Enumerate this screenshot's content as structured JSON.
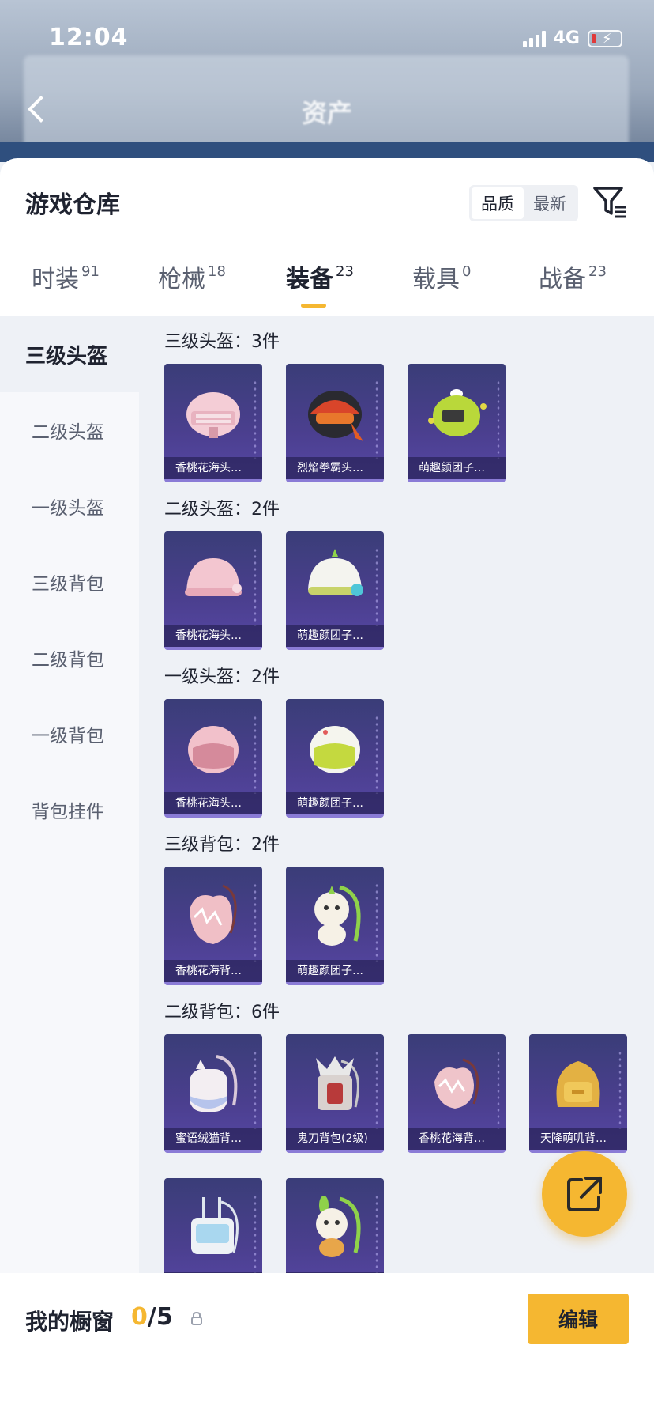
{
  "status_bar": {
    "time": "12:04",
    "network": "4G"
  },
  "header": {
    "title": "资产"
  },
  "sheet": {
    "title": "游戏仓库",
    "sort_options": [
      "品质",
      "最新"
    ],
    "active_sort": "品质"
  },
  "tabs": [
    {
      "label": "时装",
      "count": "91"
    },
    {
      "label": "枪械",
      "count": "18"
    },
    {
      "label": "装备",
      "count": "23"
    },
    {
      "label": "载具",
      "count": "0"
    },
    {
      "label": "战备",
      "count": "23"
    }
  ],
  "categories": [
    "三级头盔",
    "二级头盔",
    "一级头盔",
    "三级背包",
    "二级背包",
    "一级背包",
    "背包挂件"
  ],
  "sections": [
    {
      "title": "三级头盔：3件",
      "items": [
        "香桃花海头…",
        "烈焰拳霸头…",
        "萌趣颜团子…"
      ]
    },
    {
      "title": "二级头盔：2件",
      "items": [
        "香桃花海头…",
        "萌趣颜团子…"
      ]
    },
    {
      "title": "一级头盔：2件",
      "items": [
        "香桃花海头…",
        "萌趣颜团子…"
      ]
    },
    {
      "title": "三级背包：2件",
      "items": [
        "香桃花海背…",
        "萌趣颜团子…"
      ]
    },
    {
      "title": "二级背包：6件",
      "items": [
        "蜜语绒猫背…",
        "鬼刀背包(2级)",
        "香桃花海背…",
        "天降萌叽背…",
        "",
        ""
      ]
    }
  ],
  "showcase": {
    "label": "我的橱窗",
    "current": "0",
    "total": "/5",
    "edit_label": "编辑"
  },
  "icons": {
    "back": "chevron-left-icon",
    "filter": "filter-list-icon",
    "lock": "lock-icon",
    "share": "share-external-icon"
  },
  "colors": {
    "accent": "#f5b731",
    "card_bg": "#3f3f86",
    "text_primary": "#1f2330"
  }
}
